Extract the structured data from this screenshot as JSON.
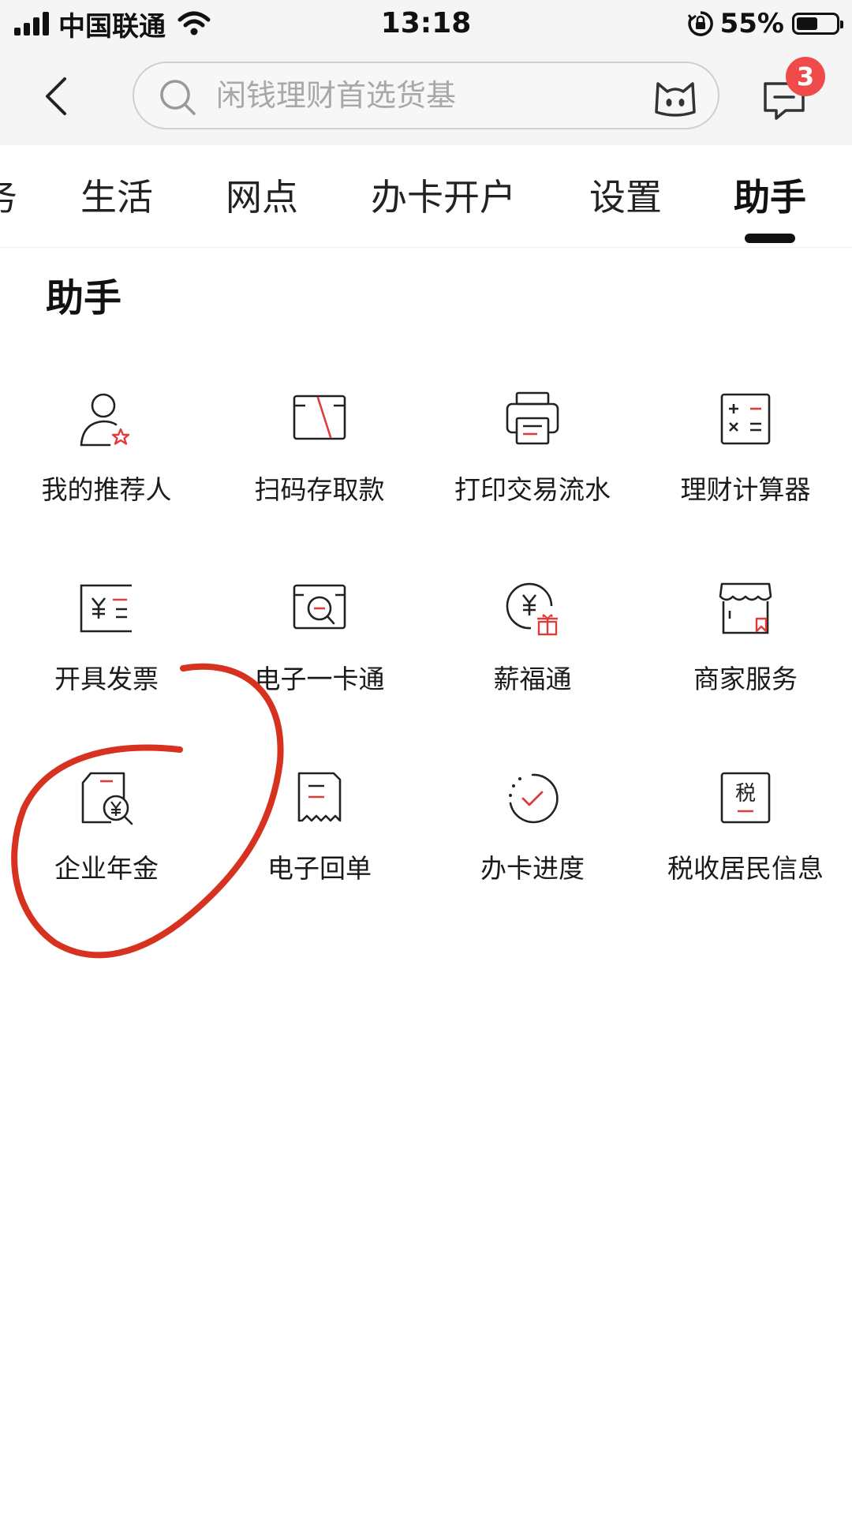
{
  "status_bar": {
    "carrier": "中国联通",
    "time": "13:18",
    "battery_percent": "55%",
    "battery_level": 0.55
  },
  "header": {
    "search_placeholder": "闲钱理财首选货基",
    "message_badge": "3"
  },
  "tabs": [
    "务",
    "生活",
    "网点",
    "办卡开户",
    "设置",
    "助手"
  ],
  "active_tab": "助手",
  "section": {
    "title": "助手"
  },
  "grid": [
    {
      "label": "我的推荐人",
      "icon": "referrer-icon"
    },
    {
      "label": "扫码存取款",
      "icon": "scan-deposit-icon"
    },
    {
      "label": "打印交易流水",
      "icon": "printer-icon"
    },
    {
      "label": "理财计算器",
      "icon": "calculator-icon"
    },
    {
      "label": "开具发票",
      "icon": "invoice-icon"
    },
    {
      "label": "电子一卡通",
      "icon": "ecard-icon"
    },
    {
      "label": "薪福通",
      "icon": "salary-icon"
    },
    {
      "label": "商家服务",
      "icon": "store-icon"
    },
    {
      "label": "企业年金",
      "icon": "pension-icon"
    },
    {
      "label": "电子回单",
      "icon": "receipt-icon"
    },
    {
      "label": "办卡进度",
      "icon": "progress-icon"
    },
    {
      "label": "税收居民信息",
      "icon": "tax-icon",
      "icon_text": "税"
    }
  ],
  "colors": {
    "accent": "#e03c3c",
    "annotation": "#d7321f",
    "icon_stroke": "#222222",
    "badge": "#ef4b4b"
  }
}
